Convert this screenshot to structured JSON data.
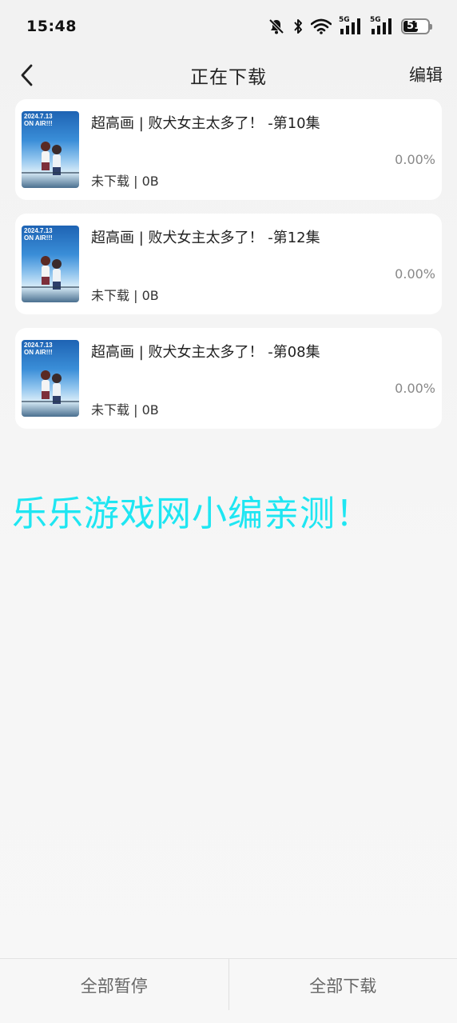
{
  "status_bar": {
    "time": "15:48",
    "battery": "51",
    "network_1": "5G",
    "network_2": "5G",
    "icons": [
      "bell-muted-icon",
      "bluetooth-icon",
      "wifi-icon",
      "signal-5g-icon",
      "signal-5g-icon",
      "battery-icon"
    ]
  },
  "header": {
    "title": "正在下载",
    "edit_label": "编辑",
    "back_icon": "chevron-left-icon"
  },
  "downloads": [
    {
      "title": "超高画 | 败犬女主太多了！ -第10集",
      "status": "未下载 | 0B",
      "progress": "0.00%",
      "thumb_text": [
        "2024.7.13",
        "ON AIR!!!"
      ]
    },
    {
      "title": "超高画 | 败犬女主太多了！ -第12集",
      "status": "未下载 | 0B",
      "progress": "0.00%",
      "thumb_text": [
        "2024.7.13",
        "ON AIR!!!"
      ]
    },
    {
      "title": "超高画 | 败犬女主太多了！ -第08集",
      "status": "未下载 | 0B",
      "progress": "0.00%",
      "thumb_text": [
        "2024.7.13",
        "ON AIR!!!"
      ]
    }
  ],
  "watermark": "乐乐游戏网小编亲测！",
  "footer": {
    "pause_all": "全部暂停",
    "download_all": "全部下载"
  },
  "colors": {
    "watermark": "#1ee6f2",
    "background": "#f4f4f4",
    "card": "#ffffff",
    "progress_text": "#888888"
  }
}
